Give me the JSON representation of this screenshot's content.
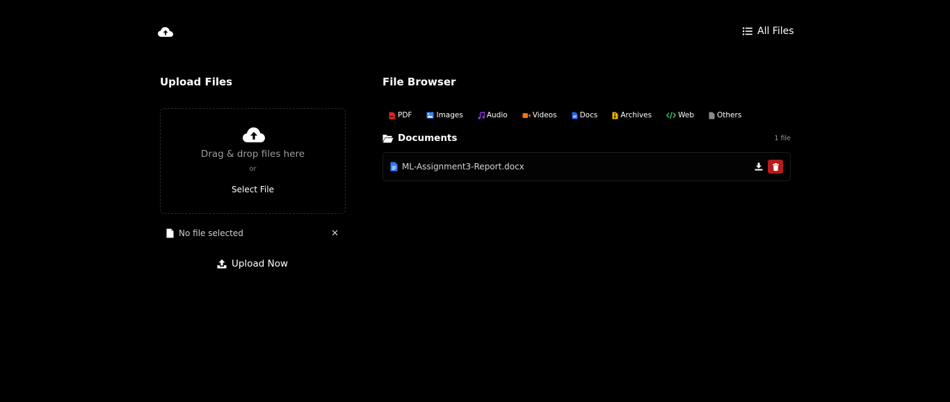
{
  "header": {
    "logo_icon": "cloud-upload-icon",
    "all_files_label": "All Files",
    "all_files_icon": "list-icon"
  },
  "upload": {
    "title": "Upload Files",
    "drop_text": "Drag & drop files here",
    "or_text": "or",
    "select_file_label": "Select File",
    "status_text": "No file selected",
    "clear_label": "✕",
    "upload_now_label": "Upload Now"
  },
  "browser": {
    "title": "File Browser",
    "tabs": [
      {
        "label": "PDF",
        "icon": "pdf-icon",
        "color": "#e02424"
      },
      {
        "label": "Images",
        "icon": "image-icon",
        "color": "#3b82f6"
      },
      {
        "label": "Audio",
        "icon": "music-icon",
        "color": "#9333ea"
      },
      {
        "label": "Videos",
        "icon": "video-icon",
        "color": "#f97316"
      },
      {
        "label": "Docs",
        "icon": "doc-icon",
        "color": "#2563eb"
      },
      {
        "label": "Archives",
        "icon": "archive-icon",
        "color": "#eab308"
      },
      {
        "label": "Web",
        "icon": "code-icon",
        "color": "#22c55e"
      },
      {
        "label": "Others",
        "icon": "file-icon",
        "color": "#8b8b8b"
      }
    ],
    "section_title": "Documents",
    "section_count": "1 file",
    "files": [
      {
        "name": "ML-Assignment3-Report.docx",
        "icon": "doc-icon",
        "color": "#2f7bf5"
      }
    ]
  },
  "colors": {
    "background": "#000000",
    "delete": "#b51c1c"
  }
}
